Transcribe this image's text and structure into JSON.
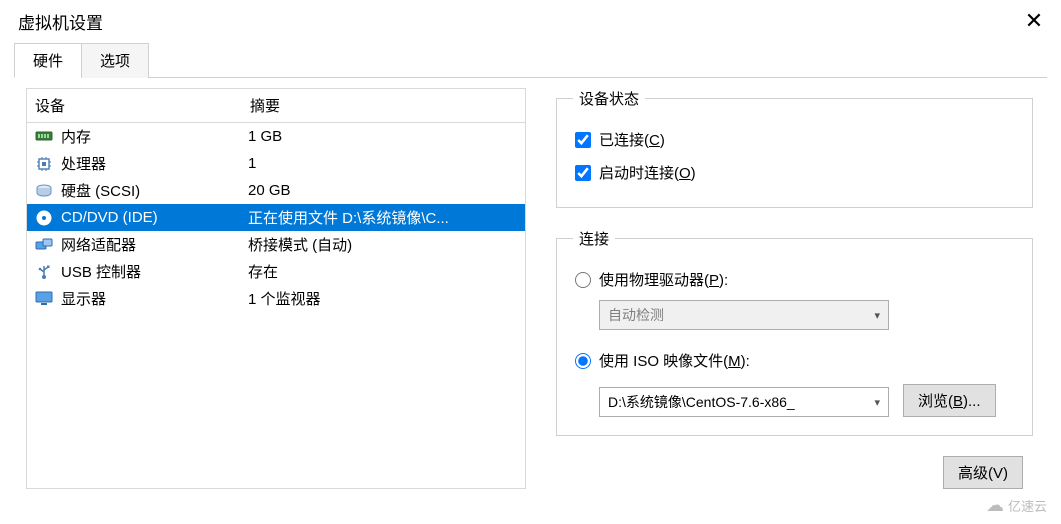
{
  "window": {
    "title": "虚拟机设置"
  },
  "tabs": {
    "hardware": "硬件",
    "options": "选项"
  },
  "device_header": {
    "device": "设备",
    "summary": "摘要"
  },
  "devices": [
    {
      "icon": "memory",
      "label": "内存",
      "summary": "1 GB",
      "selected": false
    },
    {
      "icon": "cpu",
      "label": "处理器",
      "summary": "1",
      "selected": false
    },
    {
      "icon": "disk",
      "label": "硬盘 (SCSI)",
      "summary": "20 GB",
      "selected": false
    },
    {
      "icon": "cd",
      "label": "CD/DVD (IDE)",
      "summary": "正在使用文件 D:\\系统镜像\\C...",
      "selected": true
    },
    {
      "icon": "net",
      "label": "网络适配器",
      "summary": "桥接模式 (自动)",
      "selected": false
    },
    {
      "icon": "usb",
      "label": "USB 控制器",
      "summary": "存在",
      "selected": false
    },
    {
      "icon": "display",
      "label": "显示器",
      "summary": "1 个监视器",
      "selected": false
    }
  ],
  "status": {
    "legend": "设备状态",
    "connected_label": "已连接(",
    "connected_key": "C",
    "connected_suffix": ")",
    "connect_on_start_label": "启动时连接(",
    "connect_on_start_key": "O",
    "connect_on_start_suffix": ")"
  },
  "connection": {
    "legend": "连接",
    "physical_label": "使用物理驱动器(",
    "physical_key": "P",
    "physical_suffix": "):",
    "physical_combo": "自动检测",
    "iso_label": "使用 ISO 映像文件(",
    "iso_key": "M",
    "iso_suffix": "):",
    "iso_path": "D:\\系统镜像\\CentOS-7.6-x86_",
    "browse_label": "浏览(",
    "browse_key": "B",
    "browse_suffix": ")..."
  },
  "advanced": {
    "label": "高级(V)"
  },
  "watermark": "亿速云"
}
